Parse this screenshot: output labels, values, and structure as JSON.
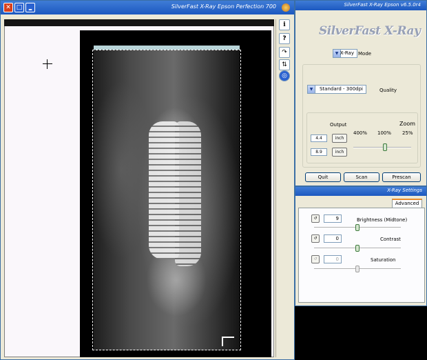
{
  "preview_window": {
    "title": "SilverFast X-Ray Epson Perfection 700",
    "icons": {
      "close": "close-icon",
      "minimize": "minimize-icon",
      "maximize": "maximize-icon",
      "app": "app-icon"
    },
    "toolbar": {
      "info_label": "i",
      "help_label": "?",
      "rotate_icon": "rotate-icon",
      "flip_icon": "flip-icon",
      "auto_icon": "auto-adjust-icon"
    }
  },
  "main_panel": {
    "title": "SilverFast X-Ray Epson v6.5.0r4",
    "brand": "SilverFast X-Ray",
    "mode": {
      "label": "Mode",
      "value": "X-Ray"
    },
    "quality": {
      "label": "Quality",
      "value": "Standard - 300dpi"
    },
    "zoom": {
      "label": "Zoom",
      "output_label": "Output",
      "ticks": [
        "400%",
        "100%",
        "25%"
      ],
      "position": 0.45
    },
    "output": {
      "width": "4.4",
      "height": "8.9",
      "unit_label": "inch"
    },
    "buttons": {
      "prescan": "Prescan",
      "scan": "Scan",
      "quit": "Quit"
    }
  },
  "settings_panel": {
    "title": "X-Ray Settings",
    "tab_advanced": "Advanced",
    "brightness": {
      "label": "Brightness (Midtone)",
      "value": "9",
      "position": 0.5,
      "enabled": true
    },
    "contrast": {
      "label": "Contrast",
      "value": "0",
      "position": 0.5,
      "enabled": true
    },
    "saturation": {
      "label": "Saturation",
      "value": "0",
      "position": 0.5,
      "enabled": false
    },
    "reset_icon": "reset-icon"
  },
  "colors": {
    "titlebar": "#1c58c0",
    "window_bg": "#ece9d8",
    "close_button": "#d8401c",
    "slider_thumb": "#3c7a3c"
  }
}
